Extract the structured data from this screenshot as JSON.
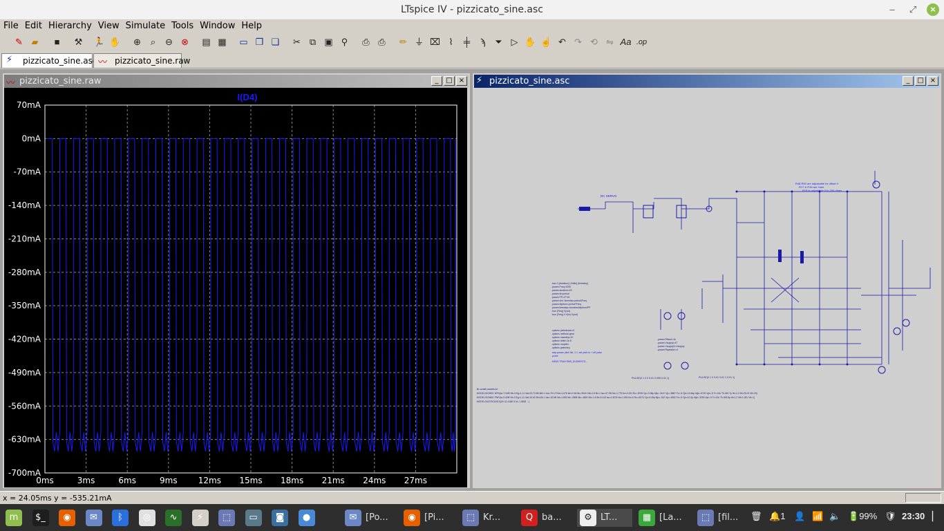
{
  "app": {
    "title": "LTspice IV - pizzicato_sine.asc",
    "controls": {
      "minimize": "–",
      "restore": "⤢",
      "close": "×"
    }
  },
  "menu": [
    "File",
    "Edit",
    "Hierarchy",
    "View",
    "Simulate",
    "Tools",
    "Window",
    "Help"
  ],
  "toolbar_icons": [
    "new-schematic",
    "open",
    "save",
    "control-panel",
    "run",
    "halt",
    "zoom-in",
    "zoom-pan",
    "zoom-out",
    "zoom-cancel",
    "autorange",
    "fit",
    "tile",
    "cascade",
    "close-all",
    "cut",
    "copy",
    "paste",
    "find",
    "print-setup",
    "print",
    "wire",
    "ground",
    "label",
    "resistor",
    "capacitor",
    "inductor",
    "diode",
    "component",
    "move",
    "drag",
    "undo",
    "redo",
    "rotate",
    "mirror",
    "text",
    "spice-directive"
  ],
  "tabs": [
    {
      "label": "pizzicato_sine.asc",
      "icon": "schematic-icon"
    },
    {
      "label": "pizzicato_sine.raw",
      "icon": "waveform-icon"
    }
  ],
  "plot_window": {
    "title": "pizzicato_sine.raw",
    "trace_label": "I(D4)",
    "trace_color": "#1a1aff",
    "background": "#000000"
  },
  "schematic_window": {
    "title": "pizzicato_sine.asc",
    "notes_top": [
      "R48 R50 are adjustable for offset V",
      "R17 & R18 are Gain",
      "R15 is adjustable 0 to 200 ohms"
    ],
    "label_dc_servo": "DC SERVO",
    "directives_left": [
      ".tran 0 {duration} {.0xfile} {timestep}",
      ".param Freq=1000",
      ".param duration=20",
      ".param dt=period",
      ".param PP=2**16",
      ".param sim: timestep=period/Freq",
      ".param dtpfrom=period*Freq",
      ".param timestep=duration/dfpfrom/PP",
      ".four {Freq} V(out)",
      ".four {Freq} 4 V(in) V(out)"
    ],
    "options": [
      ".options plotwinsize=0",
      ".options method=gear",
      ".options maxstep=10",
      ".options reltol=1e-6",
      ".options noopiter",
      ".options gminstep",
      ".step param pitch list -1 1; set pitch to +-off pulse",
      ".probe"
    ],
    "meas": ".MEAS TRAN RMS_ELEMENTS...",
    "params_mid": [
      ".param Rfixed=1k",
      ".param Vsupply=47",
      ".param Vsupply2=Vsupply",
      ".param Rspeaker=4"
    ],
    "pulse_a": "PULSE(0 1 0 0 0.01 0.005 0.01 1)",
    "pulse_b": "PULSE(0 1 0 0.01 0.01 1 0.01 1)",
    "models": [
      ".lib cordell-models.txt",
      ".MODEL BC550C NPN(Is=7.049f Xti=3 Eg=1.11 Vaf=23.73 Bf=843.1 Ise=79.17f Ne=1.678 Ikf=0.06 Nk=.5000 Xtb=1.5 Br=1 Isc=27.03f Nc=1.775 Ikr=0.321 Rc=.8705 Cjc=3.35p Mjc=.3147 Vjc=.5687 Fc=.5 Cje=13.46p Mje=.6720 Vje=.5 Tr=10n Tf=420.7p Itf=1.3 Xtf=29.23 Vtf=20)",
      ".MODEL BC560C PNP(Is=3.425f Xti=3 Eg=1.11 Vaf=19.62 Bf=434.1 Ise=18.94f Ne=1.892 Ikf=.2698 Nk=.4629 Xtb=1.5 Br=9.143 Isc=2.872f Nc=1.092 Ikr=0 Rc=.8373 Cjc=9.49p Mjc=.342 Vjc=.4962 Fc=.5 Cje=10.3p Mje=.3253 Vje=.5 Tr=10n Tf=493.8p Itf=1.2 Xtf=1.281 Vtf=1)",
      ".MODEL BZX79C6V8 D(IS=11.418E-9 N=.1.8832 ...)"
    ]
  },
  "chart_data": {
    "type": "line",
    "title": "I(D4)",
    "xlabel": "",
    "ylabel": "",
    "x_ticks": [
      "0ms",
      "3ms",
      "6ms",
      "9ms",
      "12ms",
      "15ms",
      "18ms",
      "21ms",
      "24ms",
      "27ms"
    ],
    "y_ticks": [
      "70mA",
      "0mA",
      "-70mA",
      "-140mA",
      "-210mA",
      "-280mA",
      "-350mA",
      "-420mA",
      "-490mA",
      "-560mA",
      "-630mA",
      "-700mA"
    ],
    "xlim": [
      0,
      30
    ],
    "ylim": [
      -700,
      70
    ],
    "grid": true,
    "series": [
      {
        "description": "pulse train: 0 mA baseline with 30 negative current pulses per 30ms, bottom oscillating ~-615 to -655 mA",
        "period_ms": 1.0,
        "baseline_mA": 0,
        "pulse_low_mA": -635,
        "pulse_ripple_mA": 20,
        "duty": 0.5
      }
    ]
  },
  "status": {
    "cursor": "x = 24.05ms    y = -535.21mA"
  },
  "taskbar": {
    "items": [
      {
        "label": "",
        "icon": "mint-menu-icon",
        "color": "#8fbf4f"
      },
      {
        "label": "",
        "icon": "terminal-icon",
        "color": "#1e1e1e"
      },
      {
        "label": "",
        "icon": "firefox-icon",
        "color": "#e66000"
      },
      {
        "label": "",
        "icon": "mail-icon",
        "color": "#6b87c6"
      },
      {
        "label": "",
        "icon": "bluetooth-icon",
        "color": "#2a6fdb"
      },
      {
        "label": "",
        "icon": "chrome-icon",
        "color": "#e0e0e0"
      },
      {
        "label": "",
        "icon": "sysmon-icon",
        "color": "#2a6f2a"
      },
      {
        "label": "",
        "icon": "ltspice-icon",
        "color": "#d4d0c8"
      },
      {
        "label": "",
        "icon": "cursor-icon",
        "color": "#6a7ab4"
      },
      {
        "label": "",
        "icon": "window-icon",
        "color": "#5a7a8a"
      },
      {
        "label": "",
        "icon": "camera-icon",
        "color": "#3a6fa0"
      },
      {
        "label": "",
        "icon": "bubble-icon",
        "color": "#4a8ad4"
      }
    ],
    "windows": [
      {
        "label": "[Po...",
        "icon": "mail-icon"
      },
      {
        "label": "[Pi...",
        "icon": "firefox-icon"
      },
      {
        "label": "Kr...",
        "icon": "cursor-icon"
      },
      {
        "label": "ba...",
        "icon": "q-icon"
      },
      {
        "label": "LT...",
        "icon": "gear-icon"
      },
      {
        "label": "[La...",
        "icon": "spreadsheet-icon"
      },
      {
        "label": "[fil...",
        "icon": "cursor-icon"
      }
    ],
    "tray": {
      "notifications": "1",
      "battery": "99%",
      "clock": "23:30"
    }
  }
}
